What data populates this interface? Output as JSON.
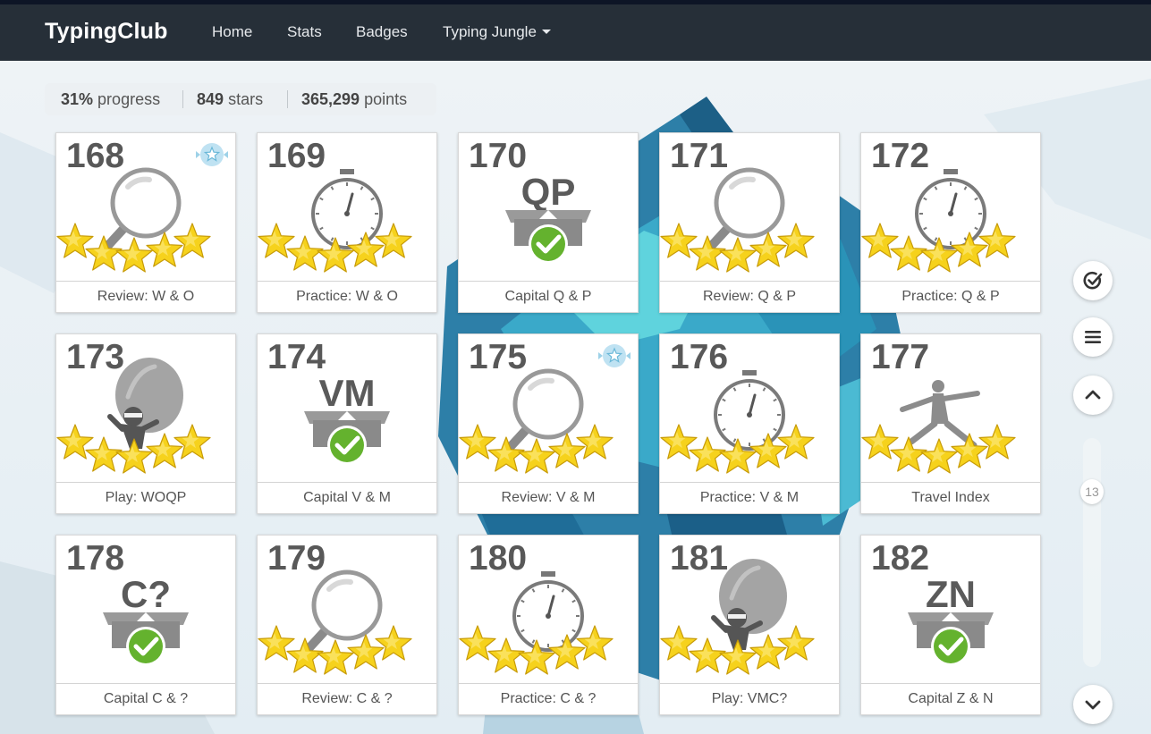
{
  "nav": {
    "brand": "TypingClub",
    "items": [
      {
        "label": "Home"
      },
      {
        "label": "Stats"
      },
      {
        "label": "Badges"
      },
      {
        "label": "Typing Jungle"
      }
    ]
  },
  "stats": {
    "progress_value": "31%",
    "progress_label": "progress",
    "stars_value": "849",
    "stars_label": "stars",
    "points_value": "365,299",
    "points_label": "points"
  },
  "lessons": [
    {
      "num": "168",
      "label": "Review: W & O",
      "icon": "magnifier-icon",
      "stars": 5,
      "badge": true
    },
    {
      "num": "169",
      "label": "Practice: W & O",
      "icon": "stopwatch-icon",
      "stars": 5,
      "badge": false
    },
    {
      "num": "170",
      "label": "Capital Q & P",
      "icon": "box-letters-icon",
      "letters": "QP",
      "completed": true,
      "stars": 0,
      "badge": false
    },
    {
      "num": "171",
      "label": "Review: Q & P",
      "icon": "magnifier-icon",
      "stars": 5,
      "badge": false
    },
    {
      "num": "172",
      "label": "Practice: Q & P",
      "icon": "stopwatch-icon",
      "stars": 5,
      "badge": false
    },
    {
      "num": "173",
      "label": "Play: WOQP",
      "icon": "balloon-ninja-icon",
      "stars": 5,
      "badge": false
    },
    {
      "num": "174",
      "label": "Capital V & M",
      "icon": "box-letters-icon",
      "letters": "VM",
      "completed": true,
      "stars": 0,
      "badge": false
    },
    {
      "num": "175",
      "label": "Review: V & M",
      "icon": "magnifier-icon",
      "stars": 5,
      "badge": true
    },
    {
      "num": "176",
      "label": "Practice: V & M",
      "icon": "stopwatch-icon",
      "stars": 5,
      "badge": false
    },
    {
      "num": "177",
      "label": "Travel Index",
      "icon": "runner-icon",
      "stars": 5,
      "badge": false
    },
    {
      "num": "178",
      "label": "Capital C & ?",
      "icon": "box-letters-icon",
      "letters": "C?",
      "completed": true,
      "stars": 0,
      "badge": false
    },
    {
      "num": "179",
      "label": "Review: C & ?",
      "icon": "magnifier-icon",
      "stars": 5,
      "badge": false
    },
    {
      "num": "180",
      "label": "Practice: C & ?",
      "icon": "stopwatch-icon",
      "stars": 5,
      "badge": false
    },
    {
      "num": "181",
      "label": "Play: VMC?",
      "icon": "balloon-ninja-icon",
      "stars": 5,
      "badge": false
    },
    {
      "num": "182",
      "label": "Capital Z & N",
      "icon": "box-letters-icon",
      "letters": "ZN",
      "completed": true,
      "stars": 0,
      "badge": false
    }
  ],
  "side": {
    "scroll_position": "13",
    "buttons": [
      "check-circle-icon",
      "menu-icon",
      "chevron-up-icon",
      "chevron-down-icon"
    ]
  },
  "colors": {
    "navbar": "#262f38",
    "star": "#f6d21c",
    "check": "#64b22e",
    "icon_gray": "#8a8a8a"
  }
}
